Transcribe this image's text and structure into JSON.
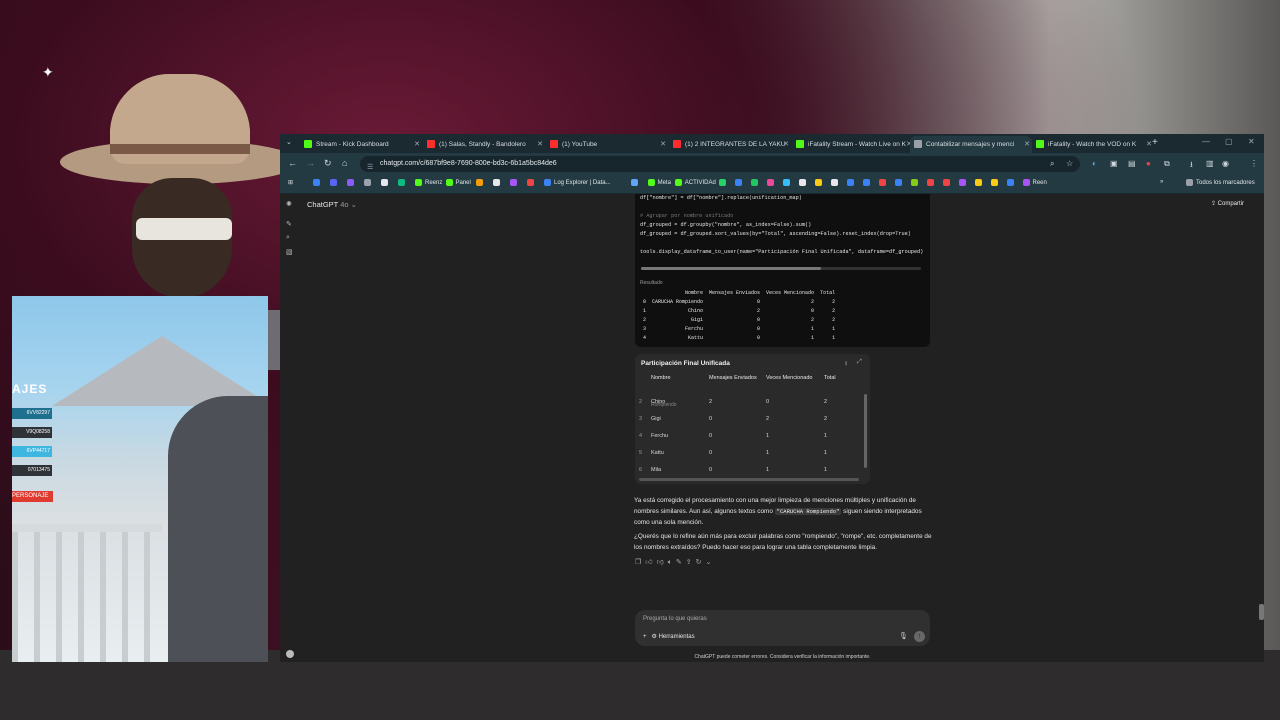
{
  "overlay": {
    "title": "AJES",
    "tags": [
      "6VV82297",
      "V9Q08258",
      "6VP44717",
      "07013475"
    ],
    "button": "PERSONAJE"
  },
  "browser": {
    "tabs": [
      {
        "label": "Stream - Kick Dashboard",
        "color": "#53fc18"
      },
      {
        "label": "(1) Salas, Standly - Bandolero",
        "color": "#ff2e2e"
      },
      {
        "label": "(1) YouTube",
        "color": "#ff2e2e"
      },
      {
        "label": "(1) 2 INTEGRANTES DE LA YAKU",
        "color": "#ff2e2e"
      },
      {
        "label": "iFatality Stream - Watch Live on K",
        "color": "#53fc18"
      },
      {
        "label": "Contabilizar mensajes y menci",
        "color": "#9aa0a6"
      },
      {
        "label": "iFatality - Watch the VOD on K",
        "color": "#53fc18"
      }
    ],
    "url": "chatgpt.com/c/687bf9e8-7690-800e-bd3c-6b1a5bc84de6",
    "bookmarks": [
      {
        "label": "",
        "color": "#3b82f6"
      },
      {
        "label": "",
        "color": "#5865f2"
      },
      {
        "label": "",
        "color": "#8b5cf6"
      },
      {
        "label": "",
        "color": "#9ca3af"
      },
      {
        "label": "",
        "color": "#e5e7eb"
      },
      {
        "label": "",
        "color": "#10b981"
      },
      {
        "label": "Reenz",
        "color": "#53fc18"
      },
      {
        "label": "Panel",
        "color": "#53fc18"
      },
      {
        "label": "",
        "color": "#f59e0b"
      },
      {
        "label": "",
        "color": "#e5e7eb"
      },
      {
        "label": "",
        "color": "#a855f7"
      },
      {
        "label": "",
        "color": "#ef4444"
      },
      {
        "label": "Log Explorer | Data...",
        "color": "#3b82f6"
      },
      {
        "label": "",
        "color": "#60a5fa"
      },
      {
        "label": "Meta",
        "color": "#53fc18"
      },
      {
        "label": "ACTIVIDAd",
        "color": "#53fc18"
      }
    ],
    "bookmarks_more": [
      {
        "color": "#25d366"
      },
      {
        "color": "#3b82f6"
      },
      {
        "color": "#22c55e"
      },
      {
        "color": "#ec4899"
      },
      {
        "color": "#38bdf8"
      },
      {
        "color": "#e5e7eb"
      },
      {
        "color": "#facc15"
      },
      {
        "color": "#e5e7eb"
      },
      {
        "color": "#3b82f6"
      },
      {
        "color": "#3b82f6"
      },
      {
        "color": "#ef4444"
      },
      {
        "color": "#3b82f6"
      },
      {
        "color": "#84cc16"
      },
      {
        "color": "#ef4444"
      },
      {
        "color": "#ef4444"
      },
      {
        "color": "#a855f7"
      },
      {
        "color": "#facc15"
      },
      {
        "color": "#facc15"
      },
      {
        "color": "#3b82f6"
      }
    ],
    "bookmark_last": "Reen",
    "all_bookmarks": "Todos los marcadores"
  },
  "chat": {
    "model": "ChatGPT",
    "version": "4o",
    "share": "Compartir",
    "code": {
      "line1": "df[\"nombre\"] = df[\"nombre\"].replace(unification_map)",
      "comment": "# Agrupar por nombre unificado",
      "line2": "df_grouped = df.groupby(\"nombre\", as_index=False).sum()",
      "line3": "df_grouped = df_grouped.sort_values(by=\"Total\", ascending=False).reset_index(drop=True)",
      "line4": "tools.display_dataframe_to_user(name=\"Participación Final Unificada\", dataframe=df_grouped)",
      "result_label": "Resultado",
      "result_headers": [
        "",
        "Nombre",
        "Mensajes Enviados",
        "Veces Mencionado",
        "Total"
      ],
      "result_rows": [
        [
          "0",
          "CARUCHA  Rompiendo",
          "0",
          "2",
          "2"
        ],
        [
          "1",
          "Chino",
          "2",
          "0",
          "2"
        ],
        [
          "2",
          "Gigi",
          "0",
          "2",
          "2"
        ],
        [
          "3",
          "Ferchu",
          "0",
          "1",
          "1"
        ],
        [
          "4",
          "Kattu",
          "0",
          "1",
          "1"
        ]
      ]
    },
    "dataframe": {
      "title": "Participación Final Unificada",
      "headers": [
        "",
        "Nombre",
        "Mensajes Enviados",
        "Veces Mencionado",
        "Total"
      ],
      "partial": "Rompiendo",
      "rows": [
        [
          "2",
          "Chino",
          "2",
          "0",
          "2"
        ],
        [
          "3",
          "Gigi",
          "0",
          "2",
          "2"
        ],
        [
          "4",
          "Ferchu",
          "0",
          "1",
          "1"
        ],
        [
          "5",
          "Kattu",
          "0",
          "1",
          "1"
        ],
        [
          "6",
          "Mila",
          "0",
          "1",
          "1"
        ]
      ]
    },
    "answer": {
      "p1_a": "Ya está corregido el procesamiento con una mejor limpieza de menciones múltiples y unificación de nombres similares. Aun así, algunos textos como ",
      "p1_code": "\"CARUCHA Rompiendo\"",
      "p1_b": " siguen siendo interpretados como una sola mención.",
      "p2": "¿Querés que lo refine aún más para excluir palabras como \"rompiendo\", \"rompe\", etc. completamente de los nombres extraídos? Puedo hacer eso para lograr una tabla completamente limpia."
    },
    "composer_placeholder": "Pregunta lo que quieras",
    "tools_label": "Herramientas",
    "disclaimer": "ChatGPT puede cometer errores. Considera verificar la información importante."
  }
}
